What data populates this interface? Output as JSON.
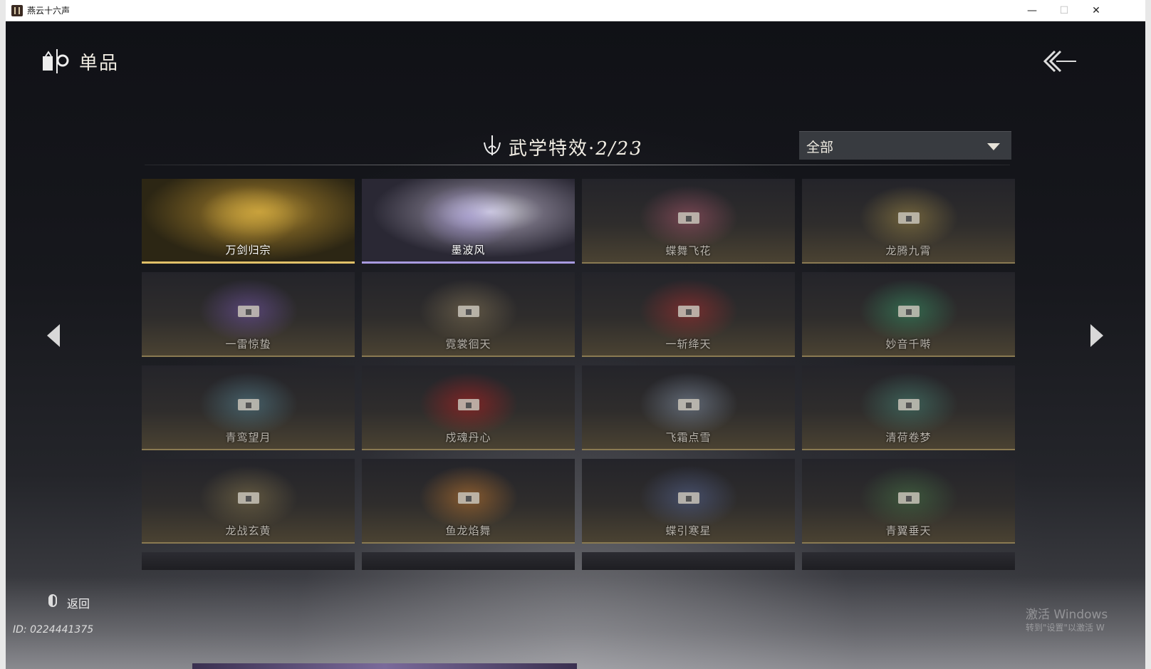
{
  "window": {
    "title": "燕云十六声",
    "minimize": "—",
    "maximize": "☐",
    "close": "✕"
  },
  "header": {
    "title": "单品"
  },
  "section": {
    "title": "武学特效·",
    "count": "2/23"
  },
  "filter": {
    "selected": "全部"
  },
  "cards": [
    {
      "label": "万剑归宗",
      "state": "unlocked",
      "color": "#c9a23c"
    },
    {
      "label": "墨波风",
      "state": "unlocked",
      "color": "#a89adf"
    },
    {
      "label": "蝶舞飞花",
      "state": "locked",
      "color": "#b05a70"
    },
    {
      "label": "龙腾九霄",
      "state": "locked",
      "color": "#a8904a"
    },
    {
      "label": "一雷惊蛰",
      "state": "locked",
      "color": "#7a5ab0"
    },
    {
      "label": "霓裳徊天",
      "state": "locked",
      "color": "#8a7a5a"
    },
    {
      "label": "一斩绛天",
      "state": "locked",
      "color": "#b03030"
    },
    {
      "label": "妙音千啭",
      "state": "locked",
      "color": "#3a9a6a"
    },
    {
      "label": "青鸾望月",
      "state": "locked",
      "color": "#5a8a9a"
    },
    {
      "label": "戍魂丹心",
      "state": "locked",
      "color": "#c02020"
    },
    {
      "label": "飞霜点雪",
      "state": "locked",
      "color": "#8a9ab0"
    },
    {
      "label": "清荷卷梦",
      "state": "locked",
      "color": "#4a8a7a"
    },
    {
      "label": "龙战玄黄",
      "state": "locked",
      "color": "#8a7a50"
    },
    {
      "label": "鱼龙焰舞",
      "state": "locked",
      "color": "#d08030"
    },
    {
      "label": "蝶引寒星",
      "state": "locked",
      "color": "#5a6a9a"
    },
    {
      "label": "青翼垂天",
      "state": "locked",
      "color": "#4a7a4a"
    }
  ],
  "footer": {
    "return_label": "返回",
    "uid": "ID: 0224441375"
  },
  "watermark": {
    "line1": "激活 Windows",
    "line2": "转到\"设置\"以激活 W"
  }
}
